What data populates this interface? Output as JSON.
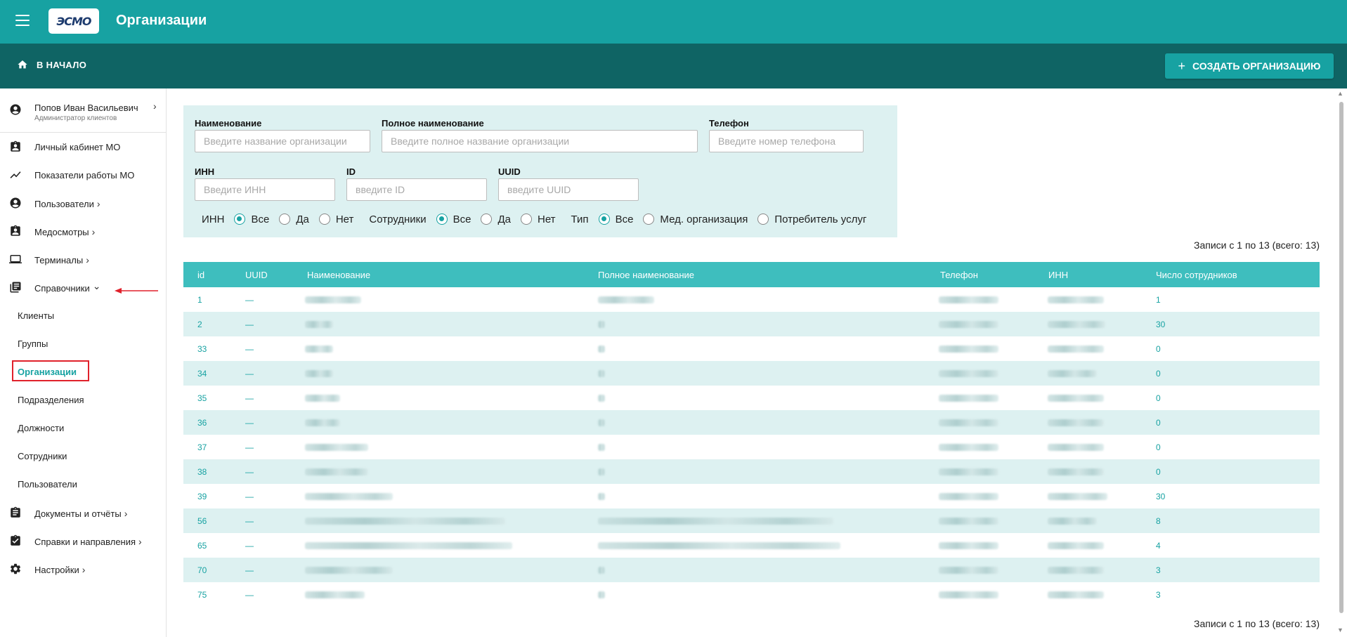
{
  "header": {
    "logo_text": "ЭСМО",
    "title": "Организации"
  },
  "subbar": {
    "home_label": "В НАЧАЛО",
    "create_label": "СОЗДАТЬ ОРГАНИЗАЦИЮ"
  },
  "user": {
    "name": "Попов Иван Васильевич",
    "role": "Администратор клиентов"
  },
  "sidebar": {
    "items": [
      {
        "label": "Личный кабинет МО",
        "icon": "clipboard-user-icon",
        "chevron": ""
      },
      {
        "label": "Показатели работы МО",
        "icon": "chart-line-icon",
        "chevron": ""
      },
      {
        "label": "Пользователи",
        "icon": "account-circle-icon",
        "chevron": "›"
      },
      {
        "label": "Медосмотры",
        "icon": "clipboard-user-icon",
        "chevron": "›"
      },
      {
        "label": "Терминалы",
        "icon": "laptop-icon",
        "chevron": "›"
      },
      {
        "label": "Справочники",
        "icon": "book-list-icon",
        "chevron": "⌄"
      }
    ],
    "subitems": [
      "Клиенты",
      "Группы",
      "Организации",
      "Подразделения",
      "Должности",
      "Сотрудники",
      "Пользователи"
    ],
    "active_subitem": "Организации",
    "bottom_items": [
      {
        "label": "Документы и отчёты",
        "icon": "clipboard-list-icon",
        "chevron": "›"
      },
      {
        "label": "Справки и направления",
        "icon": "clipboard-check-icon",
        "chevron": "›"
      },
      {
        "label": "Настройки",
        "icon": "gear-icon",
        "chevron": "›"
      }
    ]
  },
  "filters": {
    "name_label": "Наименование",
    "name_placeholder": "Введите название организации",
    "fullname_label": "Полное наименование",
    "fullname_placeholder": "Введите полное название организации",
    "phone_label": "Телефон",
    "phone_placeholder": "Введите номер телефона",
    "inn_label": "ИНН",
    "inn_placeholder": "Введите ИНН",
    "id_label": "ID",
    "id_placeholder": "введите ID",
    "uuid_label": "UUID",
    "uuid_placeholder": "введите UUID",
    "radio_groups": [
      {
        "label": "ИНН",
        "options": [
          "Все",
          "Да",
          "Нет"
        ],
        "selected": "Все"
      },
      {
        "label": "Сотрудники",
        "options": [
          "Все",
          "Да",
          "Нет"
        ],
        "selected": "Все"
      },
      {
        "label": "Тип",
        "options": [
          "Все",
          "Мед. организация",
          "Потребитель услуг"
        ],
        "selected": "Все"
      }
    ]
  },
  "records_text": "Записи с 1 по 13 (всего: 13)",
  "table": {
    "columns": [
      "id",
      "UUID",
      "Наименование",
      "Полное наименование",
      "Телефон",
      "ИНН",
      "Число сотрудников"
    ],
    "rows": [
      {
        "id": "1",
        "uuid": "—",
        "employees": "1"
      },
      {
        "id": "2",
        "uuid": "—",
        "employees": "30"
      },
      {
        "id": "33",
        "uuid": "—",
        "employees": "0"
      },
      {
        "id": "34",
        "uuid": "—",
        "employees": "0"
      },
      {
        "id": "35",
        "uuid": "—",
        "employees": "0"
      },
      {
        "id": "36",
        "uuid": "—",
        "employees": "0"
      },
      {
        "id": "37",
        "uuid": "—",
        "employees": "0"
      },
      {
        "id": "38",
        "uuid": "—",
        "employees": "0"
      },
      {
        "id": "39",
        "uuid": "—",
        "employees": "30"
      },
      {
        "id": "56",
        "uuid": "—",
        "employees": "8"
      },
      {
        "id": "65",
        "uuid": "—",
        "employees": "4"
      },
      {
        "id": "70",
        "uuid": "—",
        "employees": "3"
      },
      {
        "id": "75",
        "uuid": "—",
        "employees": "3"
      }
    ]
  },
  "colors": {
    "primary": "#17a2a2",
    "dark": "#0f6464",
    "table_header": "#3ebebe",
    "row_alt": "#ddf1f1",
    "annotation": "#e0212b"
  }
}
